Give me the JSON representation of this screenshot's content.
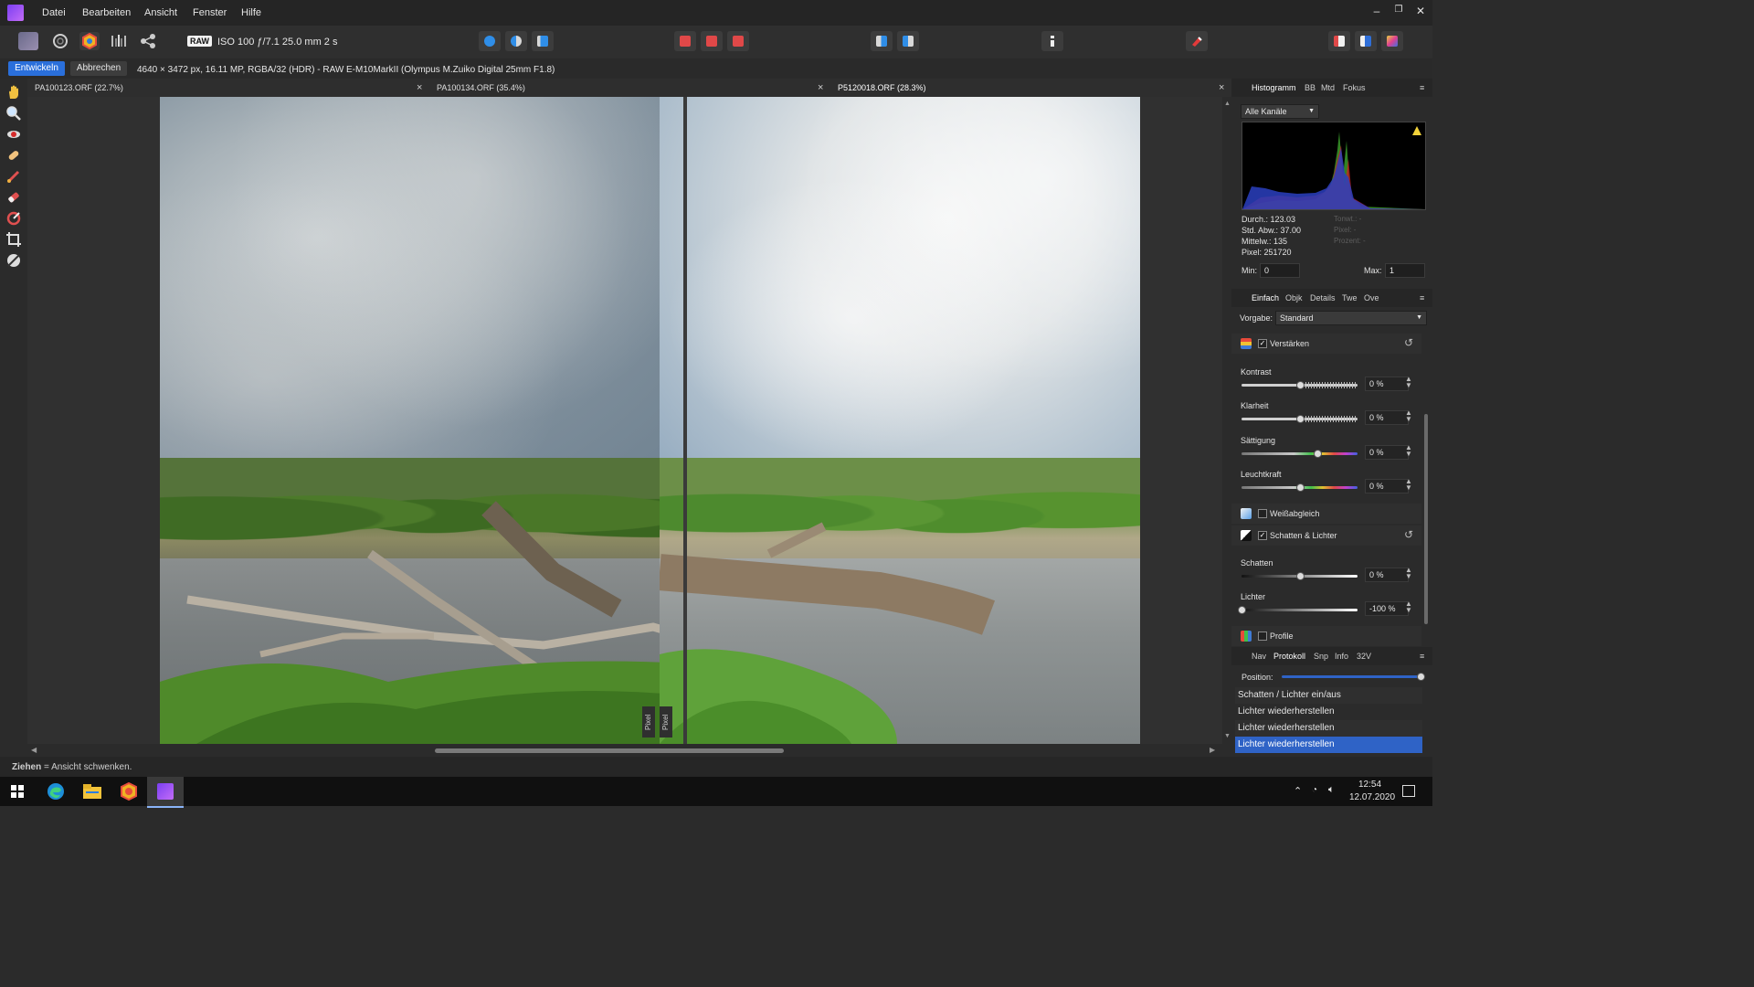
{
  "menu": {
    "items": [
      "Datei",
      "Bearbeiten",
      "Ansicht",
      "Fenster",
      "Hilfe"
    ]
  },
  "window_controls": {
    "minimize": "–",
    "restore": "❐",
    "close": "✕"
  },
  "toolbar": {
    "raw_badge": "RAW",
    "exif": "ISO 100 ƒ/7.1 25.0 mm 2 s"
  },
  "context": {
    "develop_label": "Entwickeln",
    "cancel_label": "Abbrechen",
    "image_info": "4640 × 3472 px, 16.11 MP, RGBA/32 (HDR) - RAW",
    "camera": "E-M10MarkII (Olympus M.Zuiko Digital 25mm F1.8)"
  },
  "tabs": [
    {
      "label": "PA100123.ORF (22.7%)",
      "close": "×"
    },
    {
      "label": "PA100134.ORF (35.4%)",
      "close": "×"
    },
    {
      "label": "P5120018.ORF (28.3%)",
      "close": "×"
    }
  ],
  "canvas": {
    "split_left_label": "Pixel",
    "split_right_label": "Pixel"
  },
  "status": {
    "bold": "Ziehen",
    "text": " = Ansicht schwenken."
  },
  "histogram_panel": {
    "tabs": [
      "Histogramm",
      "BB",
      "Mtd",
      "Fokus"
    ],
    "channel": "Alle Kanäle",
    "stats": {
      "mean": "Durch.: 123.03",
      "std": "Std. Abw.: 37.00",
      "median": "Mittelw.: 135",
      "pixels": "Pixel: 251720"
    },
    "stats_dim": {
      "levels": "Tonwt.: -",
      "pixel": "Pixel: -",
      "percent": "Prozent: -"
    },
    "min_label": "Min:",
    "min_value": "0",
    "max_label": "Max:",
    "max_value": "1"
  },
  "develop_panel": {
    "tabs": [
      "Einfach",
      "Objk",
      "Details",
      "Twe",
      "Ove"
    ],
    "preset_label": "Vorgabe:",
    "preset_value": "Standard",
    "sections": {
      "enhance": "Verstärken",
      "wb": "Weißabgleich",
      "shadows_highlights": "Schatten & Lichter",
      "profile": "Profile"
    },
    "sliders": {
      "contrast": {
        "label": "Kontrast",
        "value": "0 %",
        "fraction": 0.5
      },
      "clarity": {
        "label": "Klarheit",
        "value": "0 %",
        "fraction": 0.5
      },
      "saturation": {
        "label": "Sättigung",
        "value": "0 %",
        "fraction": 0.65
      },
      "vibrance": {
        "label": "Leuchtkraft",
        "value": "0 %",
        "fraction": 0.5
      },
      "shadows": {
        "label": "Schatten",
        "value": "0 %",
        "fraction": 0.5
      },
      "highlights": {
        "label": "Lichter",
        "value": "-100 %",
        "fraction": 0.0
      }
    }
  },
  "history_panel": {
    "tabs": [
      "Nav",
      "Protokoll",
      "Snp",
      "Info",
      "32V"
    ],
    "position_label": "Position:",
    "position_fraction": 1.0,
    "entries": [
      "Schatten / Lichter ein/aus",
      "Lichter wiederherstellen",
      "Lichter wiederherstellen",
      "Lichter wiederherstellen"
    ],
    "selected_index": 3
  },
  "taskbar": {
    "time": "12:54",
    "date": "12.07.2020"
  },
  "colors": {
    "accent": "#2a6fdb",
    "selected_row": "#2f63c6",
    "bg": "#2b2b2b"
  }
}
